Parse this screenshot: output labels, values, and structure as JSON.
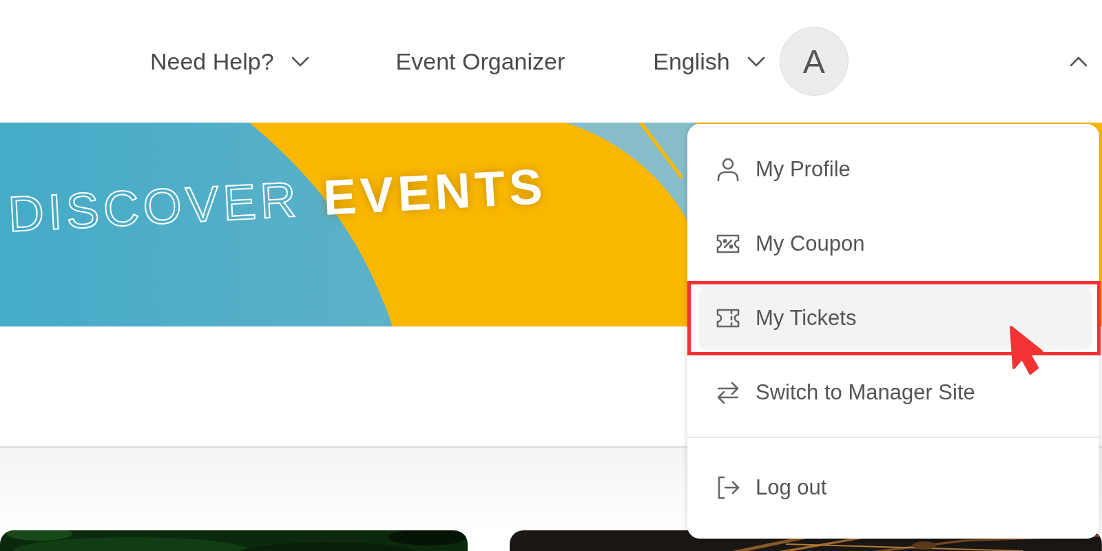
{
  "header": {
    "nav": [
      {
        "label": "Need Help?",
        "kind": "dropdown"
      },
      {
        "label": "Event Organizer",
        "kind": "link"
      },
      {
        "label": "English",
        "kind": "dropdown"
      }
    ],
    "avatar": {
      "initial": "A"
    },
    "menu_toggle": {
      "expanded": true
    }
  },
  "banner": {
    "outline_text": "DISCOVER",
    "bold_text": "EVENTS"
  },
  "user_menu": {
    "items": [
      {
        "label": "My Profile",
        "kind": "profile",
        "selected": false,
        "annotated": false,
        "divider_before": false
      },
      {
        "label": "My Coupon",
        "kind": "coupon",
        "selected": false,
        "annotated": false,
        "divider_before": false
      },
      {
        "label": "My Tickets",
        "kind": "ticket",
        "selected": true,
        "annotated": true,
        "divider_before": false
      },
      {
        "label": "Switch to Manager Site",
        "kind": "switch",
        "selected": false,
        "annotated": false,
        "divider_before": false
      },
      {
        "label": "Log out",
        "kind": "logout",
        "selected": false,
        "annotated": false,
        "divider_before": true
      }
    ]
  }
}
